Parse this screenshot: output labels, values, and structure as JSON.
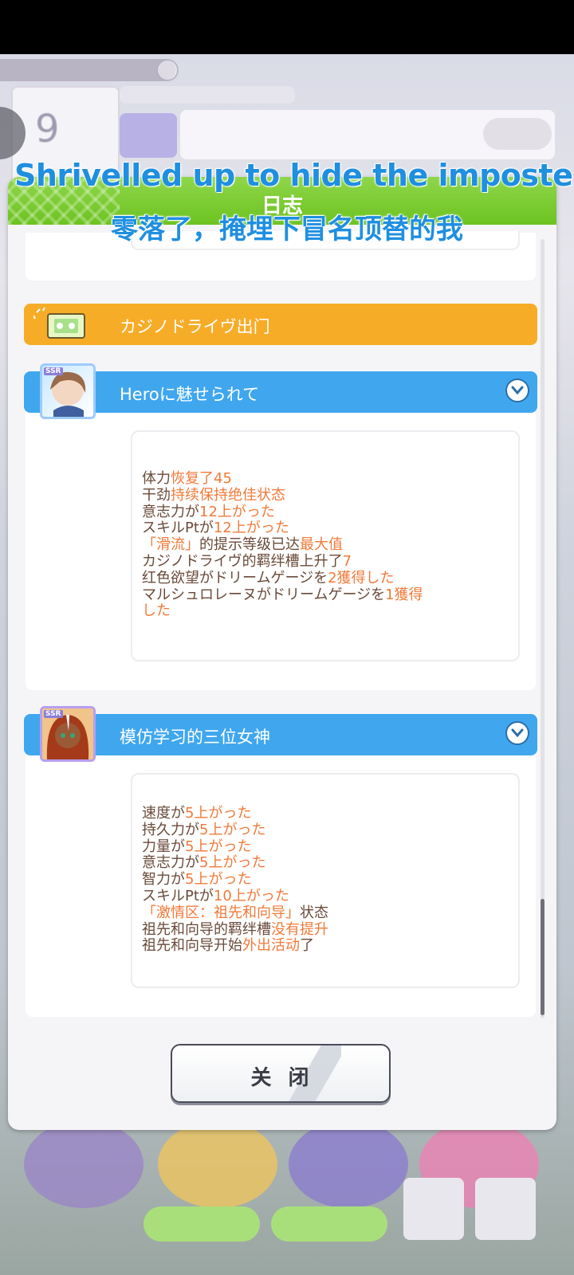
{
  "overlay": {
    "subtitle_en": "Shrivelled up to hide the imposter in",
    "subtitle_zh": "零落了，掩埋下冒名顶替的我"
  },
  "dialog": {
    "title": "日志",
    "close_label": "关 闭"
  },
  "events": [
    {
      "type": "outing",
      "label": "カジノドライヴ出门",
      "color": "#f7ac28"
    },
    {
      "type": "support",
      "label": "Heroに魅せられて",
      "badge": "SSR",
      "lines": [
        [
          {
            "t": "体力"
          },
          {
            "t": "恢复了45",
            "hl": true
          }
        ],
        [
          {
            "t": "干劲"
          },
          {
            "t": "持续保持绝佳状态",
            "hl": true
          }
        ],
        [
          {
            "t": "意志力が"
          },
          {
            "t": "12上がった",
            "hl": true
          }
        ],
        [
          {
            "t": "スキルPtが"
          },
          {
            "t": "12上がった",
            "hl": true
          }
        ],
        [
          {
            "t": "「滑流」",
            "hl": true
          },
          {
            "t": "的提示等级已达"
          },
          {
            "t": "最大值",
            "hl": true
          }
        ],
        [
          {
            "t": "カジノドライヴ的羁绊槽上升了"
          },
          {
            "t": "7",
            "hl": true
          }
        ],
        [
          {
            "t": "红色欲望がドリームゲージを"
          },
          {
            "t": "2獲得した",
            "hl": true
          }
        ],
        [
          {
            "t": "マルシュロレーヌがドリームゲージを"
          },
          {
            "t": "1獲得",
            "hl": true
          }
        ],
        [
          {
            "t": "した",
            "hl": true
          }
        ]
      ]
    },
    {
      "type": "support",
      "label": "模仿学习的三位女神",
      "badge": "SSR",
      "lines": [
        [
          {
            "t": "速度が"
          },
          {
            "t": "5上がった",
            "hl": true
          }
        ],
        [
          {
            "t": "持久力が"
          },
          {
            "t": "5上がった",
            "hl": true
          }
        ],
        [
          {
            "t": "力量が"
          },
          {
            "t": "5上がった",
            "hl": true
          }
        ],
        [
          {
            "t": "意志力が"
          },
          {
            "t": "5上がった",
            "hl": true
          }
        ],
        [
          {
            "t": "智力が"
          },
          {
            "t": "5上がった",
            "hl": true
          }
        ],
        [
          {
            "t": "スキルPtが"
          },
          {
            "t": "10上がった",
            "hl": true
          }
        ],
        [
          {
            "t": "「激情区：祖先和向导」",
            "hl": true
          },
          {
            "t": "状态"
          }
        ],
        [
          {
            "t": "祖先和向导的羁绊槽"
          },
          {
            "t": "没有提升",
            "hl": true
          }
        ],
        [
          {
            "t": "祖先和向导开始"
          },
          {
            "t": "外出活动",
            "hl": true
          },
          {
            "t": "了"
          }
        ]
      ]
    }
  ],
  "background": {
    "turn_number": "9",
    "colors": {
      "header_green": "#6cc321",
      "blue_bar": "#40a7ef",
      "orange_bar": "#f7ac28",
      "highlight_text": "#f07a3a"
    }
  }
}
